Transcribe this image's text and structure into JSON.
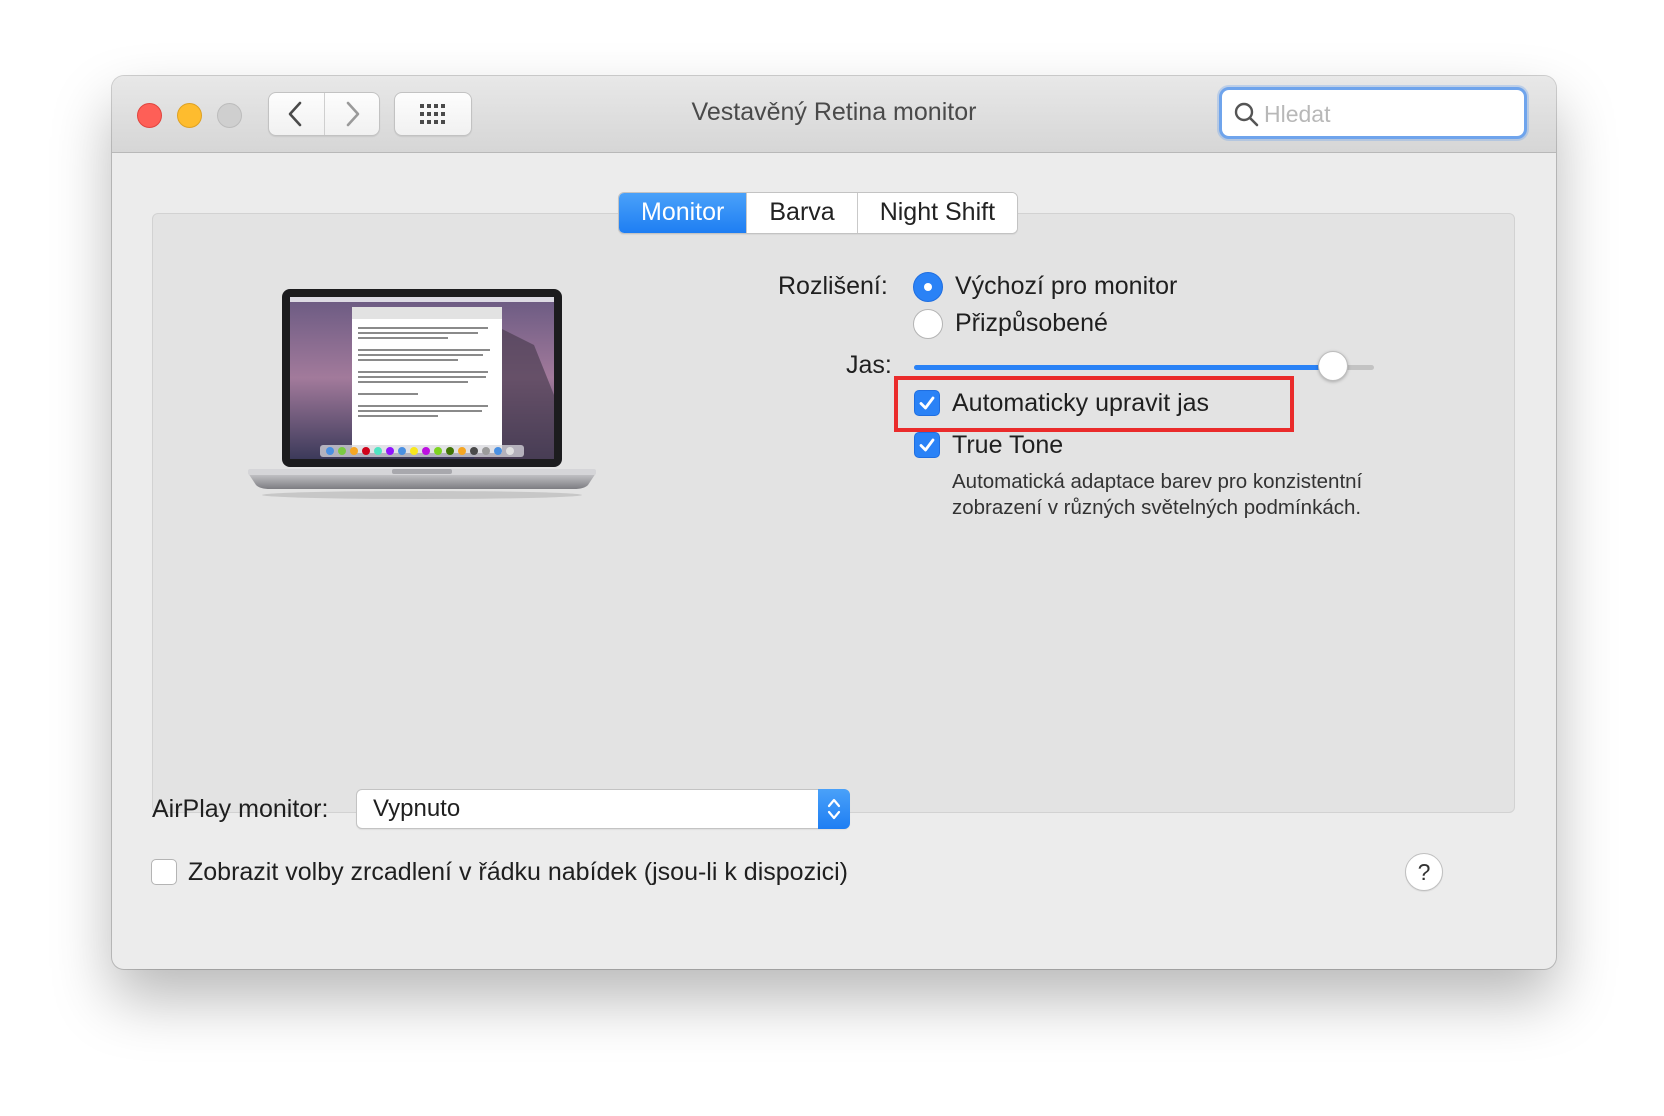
{
  "window": {
    "title": "Vestavěný Retina monitor"
  },
  "search": {
    "placeholder": "Hledat"
  },
  "tabs": [
    {
      "label": "Monitor",
      "active": true
    },
    {
      "label": "Barva",
      "active": false
    },
    {
      "label": "Night Shift",
      "active": false
    }
  ],
  "resolution": {
    "label": "Rozlišení:",
    "options": [
      {
        "label": "Výchozí pro monitor",
        "selected": true
      },
      {
        "label": "Přizpůsobené",
        "selected": false
      }
    ]
  },
  "brightness": {
    "label": "Jas:",
    "value_percent": 91
  },
  "auto_brightness": {
    "label": "Automaticky upravit jas",
    "checked": true
  },
  "true_tone": {
    "label": "True Tone",
    "checked": true,
    "description_line1": "Automatická adaptace barev pro konzistentní",
    "description_line2": "zobrazení v různých světelných podmínkách."
  },
  "airplay": {
    "label": "AirPlay monitor:",
    "value": "Vypnuto"
  },
  "mirroring": {
    "label": "Zobrazit volby zrcadlení v řádku nabídek (jsou-li k dispozici)",
    "checked": false
  },
  "help": {
    "label": "?"
  },
  "colors": {
    "accent": "#2a82f6",
    "highlight": "#ea2b2b"
  }
}
